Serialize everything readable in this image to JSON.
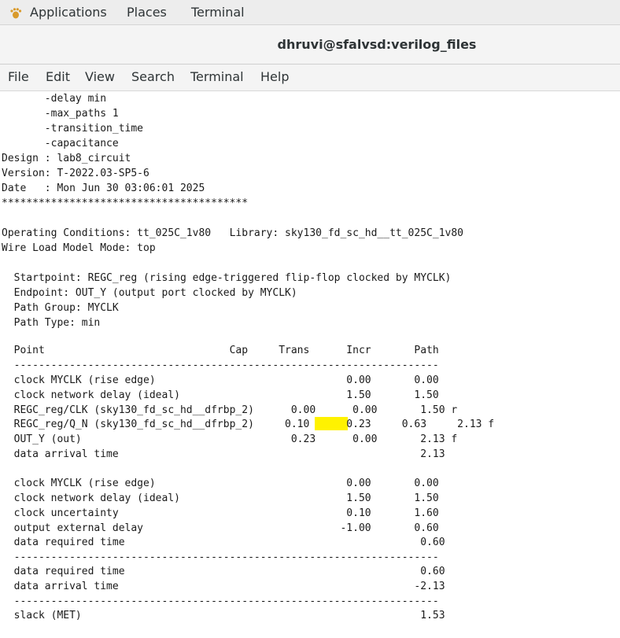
{
  "topbar": {
    "applications": "Applications",
    "places": "Places",
    "terminal": "Terminal",
    "apps_icon": "gnome-foot-icon"
  },
  "window": {
    "title": "dhruvi@sfalvsd:verilog_files"
  },
  "menu": [
    "File",
    "Edit",
    "View",
    "Search",
    "Terminal",
    "Help"
  ],
  "terminal": {
    "lines": [
      "       -delay min",
      "       -max_paths 1",
      "       -transition_time",
      "       -capacitance",
      "Design : lab8_circuit",
      "Version: T-2022.03-SP5-6",
      "Date   : Mon Jun 30 03:06:01 2025",
      "****************************************",
      "",
      "Operating Conditions: tt_025C_1v80   Library: sky130_fd_sc_hd__tt_025C_1v80",
      "Wire Load Model Mode: top",
      "",
      "  Startpoint: REGC_reg (rising edge-triggered flip-flop clocked by MYCLK)",
      "  Endpoint: OUT_Y (output port clocked by MYCLK)",
      "  Path Group: MYCLK",
      "  Path Type: min",
      "",
      "  Point                              Cap     Trans      Incr       Path",
      "  ---------------------------------------------------------------------",
      "  clock MYCLK (rise edge)                               0.00       0.00",
      "  clock network delay (ideal)                           1.50       1.50",
      "  REGC_reg/CLK (sky130_fd_sc_hd__dfrbp_2)      0.00      0.00       1.50 r",
      "  REGC_reg/Q_N (sky130_fd_sc_hd__dfrbp_2)     0.10      0.23     0.63     2.13 f",
      "  OUT_Y (out)                                  0.23      0.00       2.13 f",
      "  data arrival time                                                 2.13",
      "",
      "  clock MYCLK (rise edge)                               0.00       0.00",
      "  clock network delay (ideal)                           1.50       1.50",
      "  clock uncertainty                                     0.10       1.60",
      "  output external delay                                -1.00       0.60",
      "  data required time                                                0.60",
      "  ---------------------------------------------------------------------",
      "  data required time                                                0.60",
      "  data arrival time                                                -2.13",
      "  ---------------------------------------------------------------------",
      "  slack (MET)                                                       1.53"
    ],
    "highlight_color": "#fff200"
  }
}
